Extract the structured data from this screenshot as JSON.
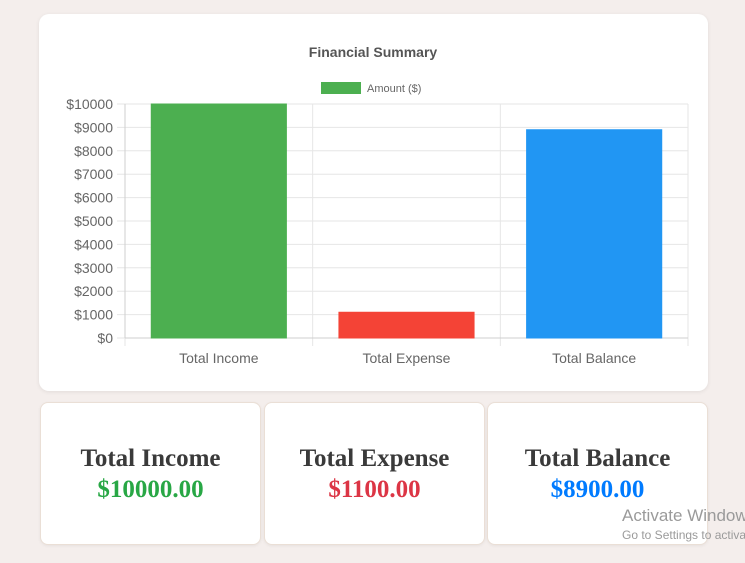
{
  "chart_data": {
    "type": "bar",
    "title": "Financial Summary",
    "categories": [
      "Total Income",
      "Total Expense",
      "Total Balance"
    ],
    "series": [
      {
        "name": "Amount ($)",
        "values": [
          10000,
          1100,
          8900
        ],
        "colors": [
          "#4caf50",
          "#f44336",
          "#2196f3"
        ],
        "legend_color": "#4caf50"
      }
    ],
    "ylim": [
      0,
      10000
    ],
    "y_ticks": [
      "$0",
      "$1000",
      "$2000",
      "$3000",
      "$4000",
      "$5000",
      "$6000",
      "$7000",
      "$8000",
      "$9000",
      "$10000"
    ],
    "grid": true,
    "legend_position": "top"
  },
  "summary": {
    "cards": [
      {
        "title": "Total Income",
        "value": "$10000.00",
        "color": "#28a745"
      },
      {
        "title": "Total Expense",
        "value": "$1100.00",
        "color": "#dc3545"
      },
      {
        "title": "Total Balance",
        "value": "$8900.00",
        "color": "#007bff"
      }
    ]
  },
  "watermark": {
    "line1": "Activate Windows",
    "line2": "Go to Settings to activate Windows."
  }
}
